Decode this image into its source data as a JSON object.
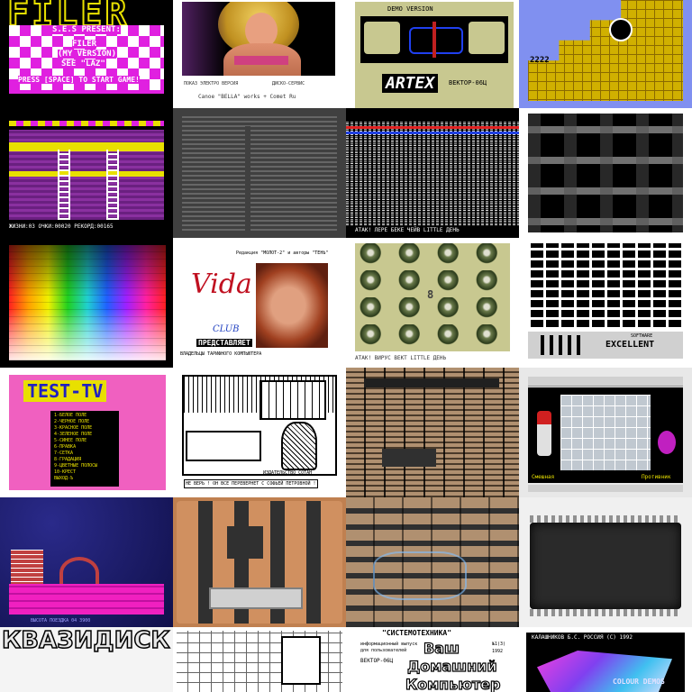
{
  "gallery": {
    "tiles": [
      {
        "id": "filer",
        "title": "FILER",
        "lines": [
          "S.E.S PRESENT:",
          "FILER",
          "(MY VERSION)",
          "SEE \"LAZ\"",
          "PRESS [SPACE] TO START GAME!"
        ]
      },
      {
        "id": "bikini-girl",
        "caption_left": "ПОКАЗ ЭЛЕКТРО ВЕРСИЯ",
        "caption_right": "ДИСКО-СЕРВИС",
        "footer": "Сanoe \"BELLA\" works + Comet Ru"
      },
      {
        "id": "tennis-game",
        "header": "DEMO VERSION",
        "logo": "ARTEX",
        "sub": "ВЕКТОР-06Ц"
      },
      {
        "id": "yellow-blocks-game",
        "numbers": "2222"
      },
      {
        "id": "ladders-game",
        "status": "ЖИЗНИ:03 ОЧКИ:00020 РЕКОРД:00165"
      },
      {
        "id": "gray-text-listing"
      },
      {
        "id": "noise-screen",
        "footer": "АТАК! ЛЕРЕ БЕКЕ ЧЕЙВ LITTLE ДЕНЬ"
      },
      {
        "id": "shelves-game"
      },
      {
        "id": "color-palette"
      },
      {
        "id": "vida-woman",
        "header": "Редакция \"МОЛОТ-2\" и авторы \"ТЕНЬ\"",
        "logo": "Vida",
        "club": "CLUB",
        "presents": "ПРЕДСТАВЛЯЕТ",
        "footer": "ВЛАДЕЛЬЦЫ ТАРИФНОГО КОМПЬЮТЕРА"
      },
      {
        "id": "spheres-game",
        "center": "8",
        "footer": "АТАК! ВИРУС ВЕКТ LITTLE ДЕНЬ"
      },
      {
        "id": "maze-game",
        "logo": "EXCELLENT",
        "brand": "SOFTWARE"
      },
      {
        "id": "test-tv",
        "title": "TEST-TV",
        "menu": [
          "1-БЕЛОЕ ПОЛЕ",
          "2-ЧЕРНОЕ ПОЛЕ",
          "3-КРАСНОЕ ПОЛЕ",
          "4-ЗЕЛЕНОЕ ПОЛЕ",
          "5-СИНЕЕ ПОЛЕ",
          "6-ПРАВКА",
          "7-СЕТКА",
          "8-ГРАДАЦИЯ",
          "9-ЦВЕТНЫЕ ПОЛОСЫ",
          "10-КРЕСТ",
          "ВЫХОД-Ъ"
        ]
      },
      {
        "id": "kitchen-comic",
        "caption": "НЕ ВЕРЬ ! ОН ВСЕ ПЕРЕВЕРНЕТ С СОФЬЕЙ ПЕТРОВНОЙ !",
        "credit": "ИЗДАТЕЛЬСТВО СОТАН"
      },
      {
        "id": "pcb-board-1"
      },
      {
        "id": "puzzle-game",
        "left_label": "Смешная",
        "right_label": "Противник"
      },
      {
        "id": "night-platform-game",
        "status": "ВЫСОТА ПОЕЗДКА 04 3900"
      },
      {
        "id": "pcb-board-2"
      },
      {
        "id": "pcb-board-3"
      },
      {
        "id": "ic-chip"
      },
      {
        "id": "kvazidisk",
        "title": "КВАЗИДИСК"
      },
      {
        "id": "schematic"
      },
      {
        "id": "magazine-cover",
        "header": "\"СИСТЕМОТЕХНИКА\"",
        "sub1": "информационный выпуск",
        "sub2": "для пользователей",
        "machine": "ВЕКТОР-06Ц",
        "issue_left": "№1(3)",
        "issue_right": "1992",
        "big1": "Ваш",
        "big2": "Домашний",
        "big3": "Компьютер"
      },
      {
        "id": "colour-credits",
        "credit": "КАЛАШНИКОВ Б.С. РОССИЯ (С) 1992",
        "tail": "COLOUR DEMOS"
      }
    ]
  },
  "colors": {
    "magenta": "#e020e0",
    "vector_yellow": "#e8e000",
    "vector_cyan": "#00e0e0",
    "vector_blue": "#2020c0",
    "pink_bg": "#f060c0",
    "olive": "#c8c890"
  }
}
